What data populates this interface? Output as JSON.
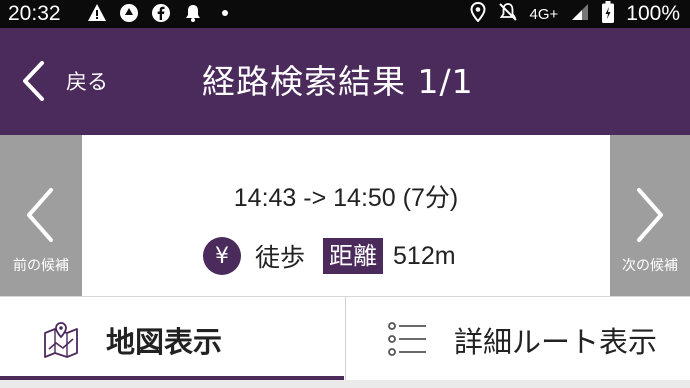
{
  "status_bar": {
    "time": "20:32",
    "network": "4G+",
    "battery": "100%",
    "left_icons": [
      "warning-icon",
      "maps-icon",
      "facebook-icon",
      "bell-icon",
      "dot-icon"
    ],
    "right_icons": [
      "location-icon",
      "mute-icon",
      "signal-icon",
      "battery-icon"
    ]
  },
  "header": {
    "back_label": "戻る",
    "title": "経路検索結果 1/1",
    "bg_color": "#4b2a5c"
  },
  "result": {
    "prev_label": "前の候補",
    "next_label": "次の候補",
    "time_range": "14:43 -> 14:50 (7分)",
    "fare_icon": "¥",
    "mode": "徒歩",
    "distance_badge": "距離",
    "distance_value": "512m"
  },
  "tabs": [
    {
      "label": "地図表示",
      "icon": "map-icon",
      "active": true
    },
    {
      "label": "詳細ルート表示",
      "icon": "list-icon",
      "active": false
    }
  ]
}
